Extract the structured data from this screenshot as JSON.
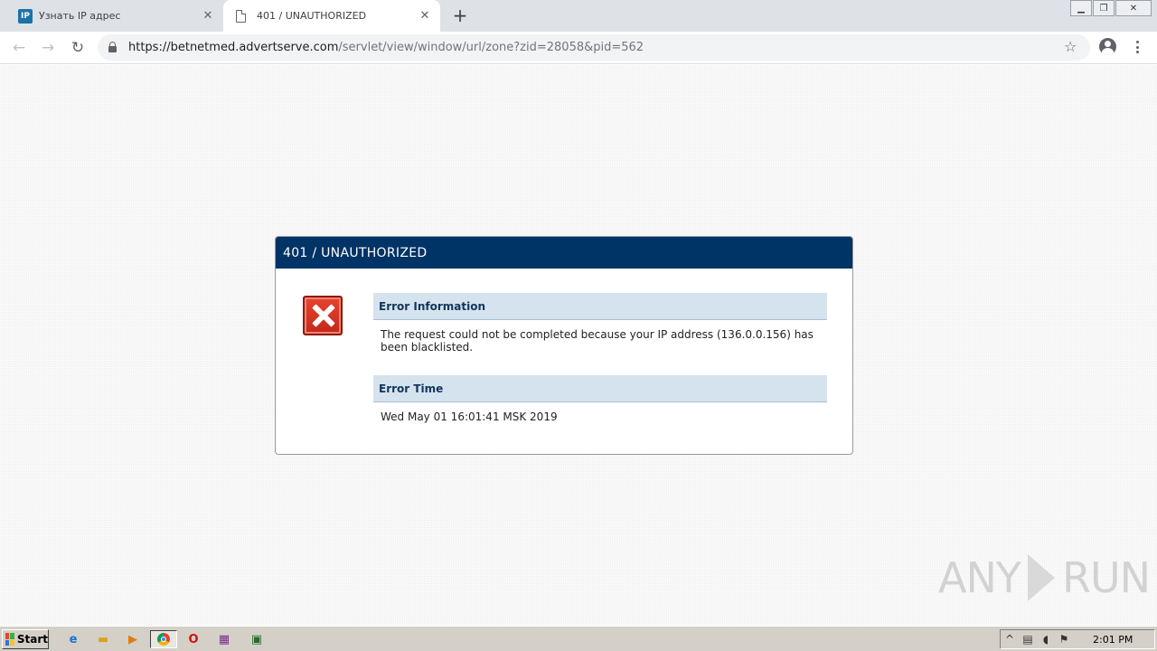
{
  "browser": {
    "tabs": [
      {
        "title": "Узнать IP адрес",
        "favicon": "IP",
        "active": false
      },
      {
        "title": "401 / UNAUTHORIZED",
        "favicon": "document-icon",
        "active": true
      }
    ],
    "new_tab_glyph": "+",
    "address": {
      "url_host": "https://betnetmed.advertserve.com",
      "url_path": "/servlet/view/window/url/zone?zid=28058&pid=562"
    }
  },
  "page": {
    "header_title": "401 / UNAUTHORIZED",
    "sections": [
      {
        "heading": "Error Information",
        "body": "The request could not be completed because your IP address (136.0.0.156) has been blacklisted."
      },
      {
        "heading": "Error Time",
        "body": "Wed May 01 16:01:41 MSK 2019"
      }
    ],
    "watermark_left": "ANY",
    "watermark_right": "RUN"
  },
  "taskbar": {
    "start_label": "Start",
    "clock": "2:01 PM",
    "pinned_icons": [
      "ie-icon",
      "folder-icon",
      "media-player-icon",
      "chrome-icon",
      "opera-icon",
      "winrar-icon",
      "network-icon"
    ]
  },
  "colors": {
    "header_bg": "#003366",
    "section_head_bg": "#d5e3ef",
    "error_icon": "#d9361f"
  }
}
